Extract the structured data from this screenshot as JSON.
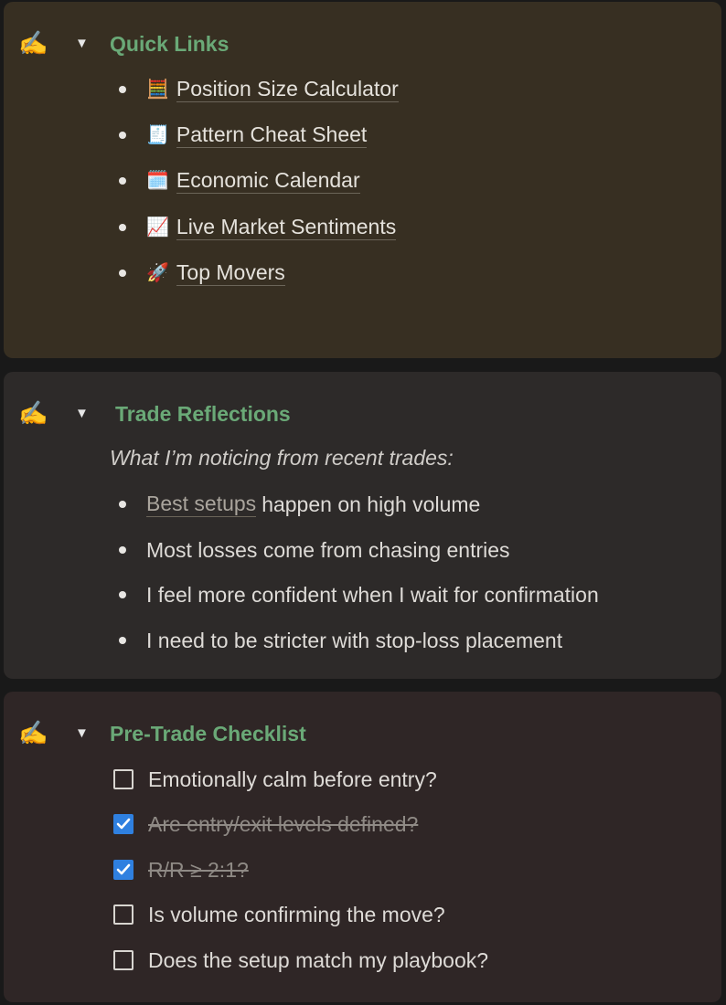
{
  "quick_links": {
    "hand_icon": "✍️",
    "toggle_icon": "▼",
    "title": "Quick Links",
    "items": [
      {
        "icon": "🧮",
        "label": "Position Size Calculator"
      },
      {
        "icon": "🧾",
        "label": "Pattern Cheat Sheet"
      },
      {
        "icon": "🗓️",
        "label": "Economic Calendar"
      },
      {
        "icon": "📈",
        "label": "Live Market Sentiments"
      },
      {
        "icon": "🚀",
        "label": "Top Movers"
      }
    ]
  },
  "trade_reflections": {
    "hand_icon": "✍️",
    "toggle_icon": "▼",
    "title": "Trade Reflections",
    "subtitle": "What I’m noticing from recent trades:",
    "items": [
      {
        "link": "Best setups",
        "text": "happen on high volume"
      },
      {
        "text": "Most losses come from chasing entries"
      },
      {
        "text": "I feel more confident when I wait for confirmation"
      },
      {
        "text": "I need to be stricter with stop-loss placement"
      }
    ]
  },
  "pre_trade_checklist": {
    "hand_icon": "✍️",
    "toggle_icon": "▼",
    "title": "Pre-Trade Checklist",
    "items": [
      {
        "label": "Emotionally calm before entry?",
        "checked": false
      },
      {
        "label": "Are entry/exit levels defined?",
        "checked": true
      },
      {
        "label": "R/R ≥ 2:1?",
        "checked": true
      },
      {
        "label": "Is volume confirming the move?",
        "checked": false
      },
      {
        "label": "Does the setup match my playbook?",
        "checked": false
      }
    ]
  },
  "colors": {
    "heading": "#6aa977",
    "checkbox_checked": "#2f80e0",
    "callout_links": "#372f22",
    "callout_reflect": "#2d2a29",
    "callout_check": "#2f2626"
  }
}
